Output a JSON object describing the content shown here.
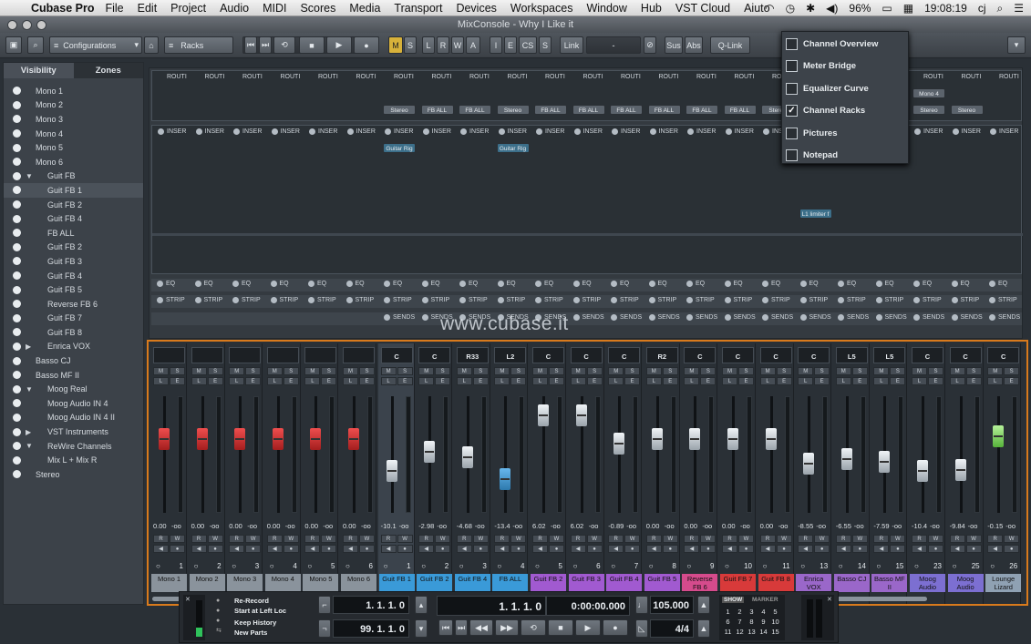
{
  "menubar": {
    "app_name": "Cubase Pro",
    "items": [
      "File",
      "Edit",
      "Project",
      "Audio",
      "MIDI",
      "Scores",
      "Media",
      "Transport",
      "Devices",
      "Workspaces",
      "Window",
      "Hub",
      "VST Cloud",
      "Aiuto"
    ],
    "battery": "96%",
    "clock": "19:08:19",
    "user": "cj"
  },
  "window": {
    "title": "MixConsole - Why I Like it"
  },
  "toolbar": {
    "configurations": "Configurations",
    "racks": "Racks",
    "m": "M",
    "s": "S",
    "l": "L",
    "r": "R",
    "w": "W",
    "a": "A",
    "i": "I",
    "e": "E",
    "cs": "CS",
    "s2": "S",
    "link": "Link",
    "link_value": "-",
    "sus": "Sus",
    "abs": "Abs",
    "qlink": "Q-Link"
  },
  "left_panel": {
    "tabs": [
      "Visibility",
      "Zones"
    ],
    "items": [
      {
        "label": "Mono 1",
        "indent": 0,
        "arrow": ""
      },
      {
        "label": "Mono 2",
        "indent": 0,
        "arrow": ""
      },
      {
        "label": "Mono 3",
        "indent": 0,
        "arrow": ""
      },
      {
        "label": "Mono 4",
        "indent": 0,
        "arrow": ""
      },
      {
        "label": "Mono 5",
        "indent": 0,
        "arrow": ""
      },
      {
        "label": "Mono 6",
        "indent": 0,
        "arrow": ""
      },
      {
        "label": "Guit FB",
        "indent": 1,
        "arrow": "down"
      },
      {
        "label": "Guit FB 1",
        "indent": 2,
        "arrow": "",
        "selected": true
      },
      {
        "label": "Guit FB 2",
        "indent": 2,
        "arrow": ""
      },
      {
        "label": "Guit FB 4",
        "indent": 2,
        "arrow": ""
      },
      {
        "label": "FB ALL",
        "indent": 2,
        "arrow": ""
      },
      {
        "label": "Guit FB 2",
        "indent": 2,
        "arrow": ""
      },
      {
        "label": "Guit FB 3",
        "indent": 2,
        "arrow": ""
      },
      {
        "label": "Guit FB 4",
        "indent": 2,
        "arrow": ""
      },
      {
        "label": "Guit FB 5",
        "indent": 2,
        "arrow": ""
      },
      {
        "label": "Reverse FB 6",
        "indent": 2,
        "arrow": ""
      },
      {
        "label": "Guit FB 7",
        "indent": 2,
        "arrow": ""
      },
      {
        "label": "Guit FB 8",
        "indent": 2,
        "arrow": ""
      },
      {
        "label": "Enrica VOX",
        "indent": 1,
        "arrow": "right"
      },
      {
        "label": "Basso CJ",
        "indent": 0,
        "arrow": ""
      },
      {
        "label": "Basso MF II",
        "indent": 0,
        "arrow": ""
      },
      {
        "label": "Moog Real",
        "indent": 1,
        "arrow": "down"
      },
      {
        "label": "Moog Audio IN 4",
        "indent": 2,
        "arrow": ""
      },
      {
        "label": "Moog Audio IN 4 II",
        "indent": 2,
        "arrow": ""
      },
      {
        "label": "VST Instruments",
        "indent": 1,
        "arrow": "right"
      },
      {
        "label": "ReWire Channels",
        "indent": 1,
        "arrow": "down"
      },
      {
        "label": "Mix  L + Mix  R",
        "indent": 2,
        "arrow": ""
      },
      {
        "label": "Stereo",
        "indent": 0,
        "arrow": ""
      }
    ]
  },
  "racks": {
    "routing_label": "ROUTI",
    "insert_label": "INSER",
    "eq_label": "EQ",
    "strip_label": "STRIP",
    "sends_label": "SENDS",
    "routing_outputs": [
      "",
      "",
      "",
      "",
      "",
      "",
      "Stereo",
      "FB ALL",
      "FB ALL",
      "Stereo",
      "FB ALL",
      "FB ALL",
      "FB ALL",
      "FB ALL",
      "FB ALL",
      "FB ALL",
      "Stereo",
      "Stereo",
      "",
      "Stereo",
      "Stereo",
      "Stereo"
    ],
    "routing_inputs": [
      "",
      "",
      "",
      "",
      "",
      "",
      "",
      "",
      "",
      "",
      "",
      "",
      "",
      "",
      "",
      "",
      "",
      "",
      "",
      "Mono 4",
      "Mono 4",
      ""
    ],
    "inserts": {
      "6": "Guitar Rig",
      "9": "Guitar Rig",
      "17": "L1 limiter f"
    }
  },
  "dropdown": {
    "items": [
      {
        "label": "Channel Overview",
        "checked": false
      },
      {
        "label": "Meter Bridge",
        "checked": false
      },
      {
        "label": "Equalizer Curve",
        "checked": false
      },
      {
        "label": "Channel Racks",
        "checked": true
      },
      {
        "label": "Pictures",
        "checked": false
      },
      {
        "label": "Notepad",
        "checked": false
      }
    ]
  },
  "watermark": "www.cubase.it",
  "mixer": {
    "channels": [
      {
        "name": "Mono 1",
        "pan": "",
        "vol": "0.00",
        "peak": "-oo",
        "num": "1",
        "color": "#8a939c",
        "fader": "red",
        "level": 0.34
      },
      {
        "name": "Mono 2",
        "pan": "",
        "vol": "0.00",
        "peak": "-oo",
        "num": "2",
        "color": "#8a939c",
        "fader": "red",
        "level": 0.34
      },
      {
        "name": "Mono 3",
        "pan": "",
        "vol": "0.00",
        "peak": "-oo",
        "num": "3",
        "color": "#8a939c",
        "fader": "red",
        "level": 0.34
      },
      {
        "name": "Mono 4",
        "pan": "",
        "vol": "0.00",
        "peak": "-oo",
        "num": "4",
        "color": "#8a939c",
        "fader": "red",
        "level": 0.34
      },
      {
        "name": "Mono 5",
        "pan": "",
        "vol": "0.00",
        "peak": "-oo",
        "num": "5",
        "color": "#8a939c",
        "fader": "red",
        "level": 0.34
      },
      {
        "name": "Mono 6",
        "pan": "",
        "vol": "0.00",
        "peak": "-oo",
        "num": "6",
        "color": "#8a939c",
        "fader": "red",
        "level": 0.34
      },
      {
        "name": "Guit FB 1",
        "pan": "C",
        "vol": "-10.1",
        "peak": "-oo",
        "num": "1",
        "color": "#3a9ad8",
        "fader": "white",
        "level": 0.67
      },
      {
        "name": "Guit FB 2",
        "pan": "C",
        "vol": "-2.98",
        "peak": "-oo",
        "num": "2",
        "color": "#3a9ad8",
        "fader": "white",
        "level": 0.47
      },
      {
        "name": "Guit FB 4",
        "pan": "R33",
        "vol": "-4.68",
        "peak": "-oo",
        "num": "3",
        "color": "#3a9ad8",
        "fader": "white",
        "level": 0.53
      },
      {
        "name": "FB ALL",
        "pan": "L2",
        "vol": "-13.4",
        "peak": "-oo",
        "num": "4",
        "color": "#3a9ad8",
        "fader": "blue",
        "level": 0.76
      },
      {
        "name": "Guit FB 2",
        "pan": "C",
        "vol": "6.02",
        "peak": "-oo",
        "num": "5",
        "color": "#a15ad0",
        "fader": "white",
        "level": 0.09
      },
      {
        "name": "Guit FB 3",
        "pan": "C",
        "vol": "6.02",
        "peak": "-oo",
        "num": "6",
        "color": "#a15ad0",
        "fader": "white",
        "level": 0.09
      },
      {
        "name": "Guit FB 4",
        "pan": "C",
        "vol": "-0.89",
        "peak": "-oo",
        "num": "7",
        "color": "#a15ad0",
        "fader": "white",
        "level": 0.38
      },
      {
        "name": "Guit FB 5",
        "pan": "R2",
        "vol": "0.00",
        "peak": "-oo",
        "num": "8",
        "color": "#a15ad0",
        "fader": "white",
        "level": 0.34
      },
      {
        "name": "Reverse FB 6",
        "pan": "C",
        "vol": "0.00",
        "peak": "-oo",
        "num": "9",
        "color": "#d54b8c",
        "fader": "white",
        "level": 0.34
      },
      {
        "name": "Guit FB 7",
        "pan": "C",
        "vol": "0.00",
        "peak": "-oo",
        "num": "10",
        "color": "#d83a3a",
        "fader": "white",
        "level": 0.34
      },
      {
        "name": "Guit FB 8",
        "pan": "C",
        "vol": "0.00",
        "peak": "-oo",
        "num": "11",
        "color": "#d83a3a",
        "fader": "white",
        "level": 0.34
      },
      {
        "name": "Enrica VOX",
        "pan": "C",
        "vol": "-8.55",
        "peak": "-oo",
        "num": "13",
        "color": "#9a67c9",
        "fader": "white",
        "level": 0.6
      },
      {
        "name": "Basso CJ",
        "pan": "L5",
        "vol": "-6.55",
        "peak": "-oo",
        "num": "14",
        "color": "#9a67c9",
        "fader": "white",
        "level": 0.55
      },
      {
        "name": "Basso MF II",
        "pan": "L5",
        "vol": "-7.59",
        "peak": "-oo",
        "num": "15",
        "color": "#9a67c9",
        "fader": "white",
        "level": 0.58
      },
      {
        "name": "Moog Audio",
        "pan": "C",
        "vol": "-10.4",
        "peak": "-oo",
        "num": "23",
        "color": "#7c6fd1",
        "fader": "white",
        "level": 0.67
      },
      {
        "name": "Moog Audio",
        "pan": "C",
        "vol": "-9.84",
        "peak": "-oo",
        "num": "25",
        "color": "#7c6fd1",
        "fader": "white",
        "level": 0.66
      },
      {
        "name": "Lounge Lizard",
        "pan": "C",
        "vol": "-0.15",
        "peak": "-oo",
        "num": "26",
        "color": "#8fa1b3",
        "fader": "green",
        "level": 0.31
      }
    ]
  },
  "transport": {
    "re_record": "Re-Record",
    "start_left": "Start at Left Loc",
    "keep_history": "Keep History",
    "new_parts": "New Parts",
    "left_loc": "1. 1. 1.    0",
    "right_loc": "99. 1. 1.    0",
    "position": "1. 1. 1.    0",
    "time": "0:00:00.000",
    "tempo": "105.000",
    "signature": "4/4",
    "show": "SHOW",
    "marker": "MARKER",
    "markers": [
      "1",
      "2",
      "3",
      "4",
      "5",
      "6",
      "7",
      "8",
      "9",
      "10",
      "11",
      "12",
      "13",
      "14",
      "15"
    ]
  }
}
